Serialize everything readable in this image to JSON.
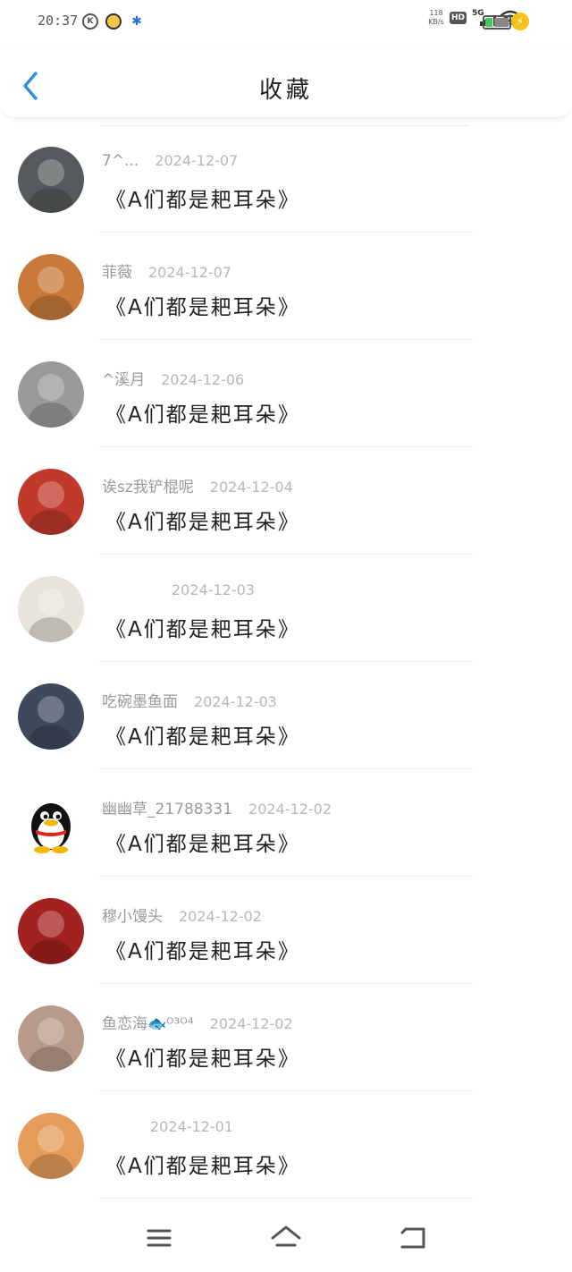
{
  "status_bar": {
    "time": "20:37",
    "net_speed_value": "118",
    "net_speed_unit": "KB/s",
    "hd_label": "HD",
    "signal_label": "5G",
    "battery_level": 0.3
  },
  "header": {
    "title": "收藏"
  },
  "favorites": [
    {
      "username": "7^...",
      "date": "2024-12-07",
      "title": "《A们都是耙耳朵》",
      "avatar_color": "#555b5c"
    },
    {
      "username": "菲薇",
      "date": "2024-12-07",
      "title": "《A们都是耙耳朵》",
      "avatar_color": "#c97a3a"
    },
    {
      "username": "^溪月",
      "date": "2024-12-06",
      "title": "《A们都是耙耳朵》",
      "avatar_color": "#9a9a9a"
    },
    {
      "username": "诶sz我铲棍呢",
      "date": "2024-12-04",
      "title": "《A们都是耙耳朵》",
      "avatar_color": "#c0392b"
    },
    {
      "username": "",
      "date": "2024-12-03",
      "title": "《A们都是耙耳朵》",
      "avatar_color": "#e8e4dc"
    },
    {
      "username": "吃碗墨鱼面",
      "date": "2024-12-03",
      "title": "《A们都是耙耳朵》",
      "avatar_color": "#3e4a5c"
    },
    {
      "username": "幽幽草_21788331",
      "date": "2024-12-02",
      "title": "《A们都是耙耳朵》",
      "avatar_color": "#ffffff"
    },
    {
      "username": "穆小馒头",
      "date": "2024-12-02",
      "title": "《A们都是耙耳朵》",
      "avatar_color": "#a3221f"
    },
    {
      "username": "鱼恋海🐟ᴼ³ᴼ⁴",
      "date": "2024-12-02",
      "title": "《A们都是耙耳朵》",
      "avatar_color": "#b89a8a"
    },
    {
      "username": "",
      "date": "2024-12-01",
      "title": "《A们都是耙耳朵》",
      "avatar_color": "#e59c5a"
    }
  ],
  "bottom_nav": {
    "items": [
      "menu-icon",
      "home-icon",
      "back-icon"
    ]
  },
  "colors": {
    "accent": "#2b8fe6",
    "divider": "#efefef"
  }
}
